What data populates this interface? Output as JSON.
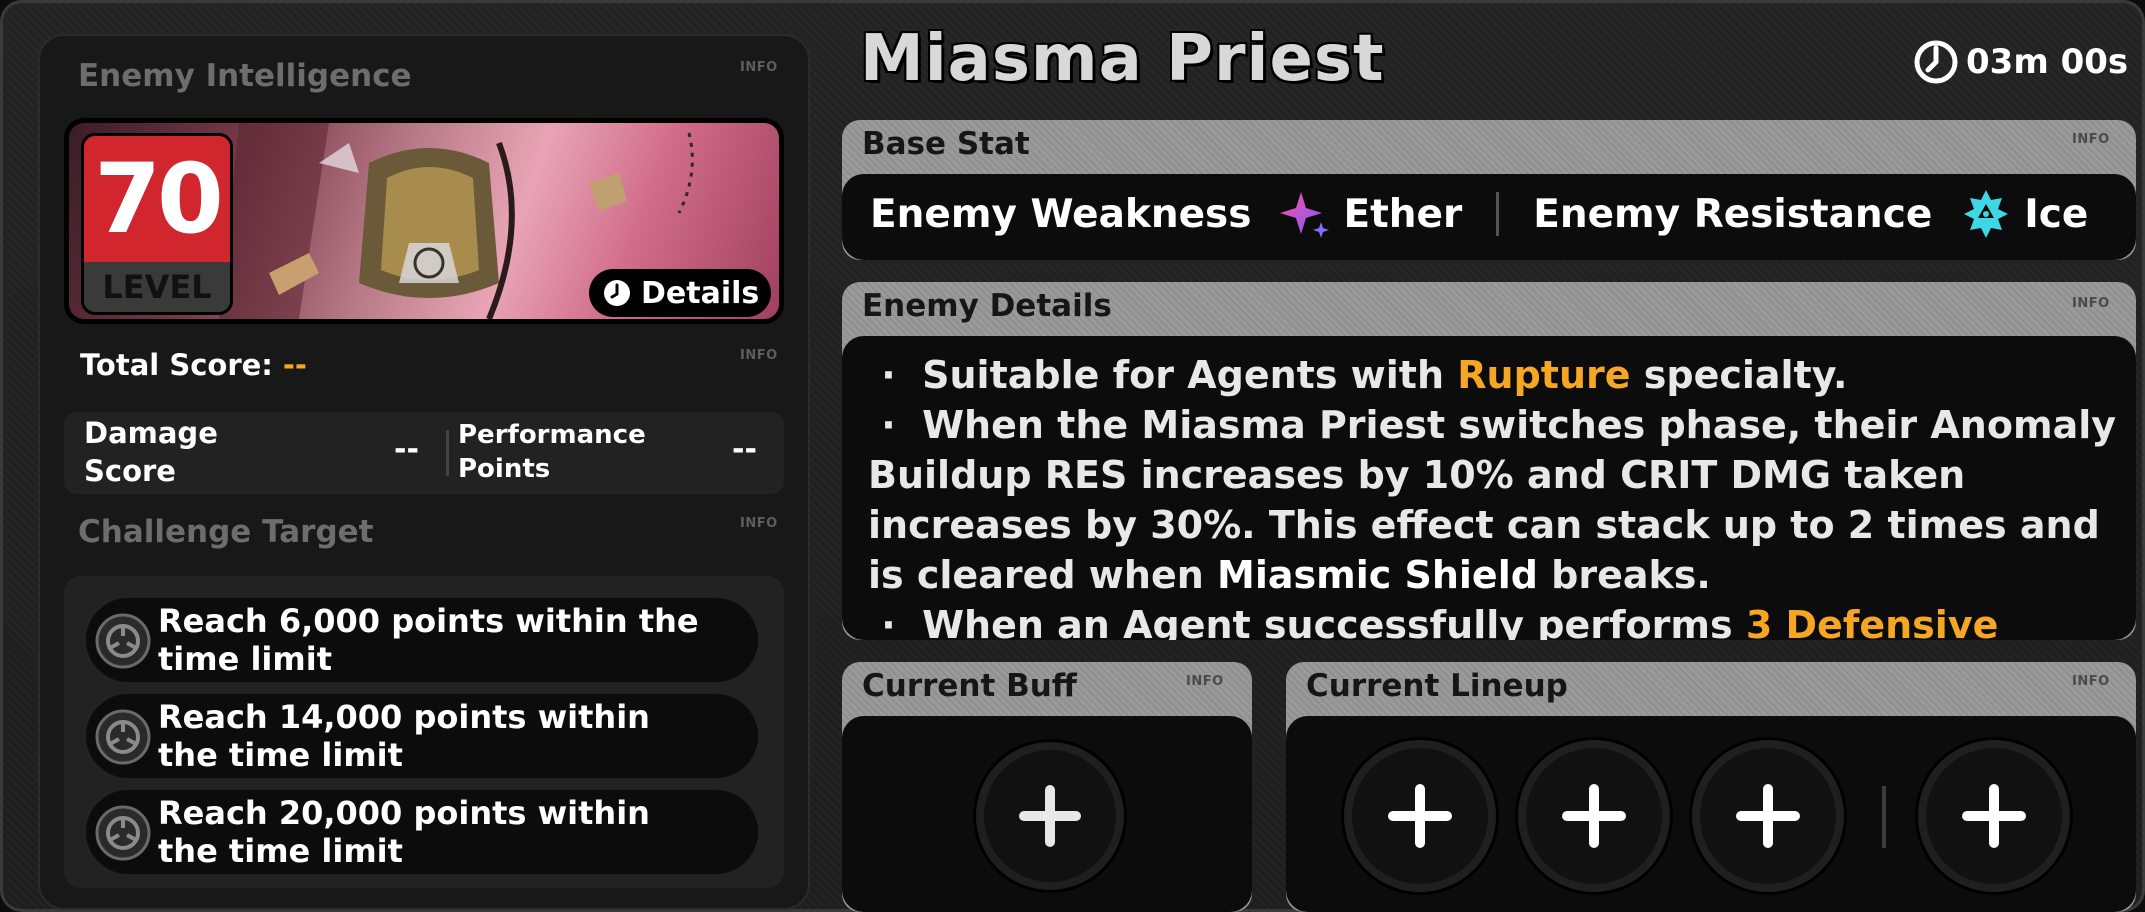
{
  "left": {
    "enemy_intelligence_title": "Enemy Intelligence",
    "info_label": "INFO",
    "level_value": "70",
    "level_label": "LEVEL",
    "details_button": "Details",
    "total_score_label": "Total Score:",
    "total_score_value": "--",
    "damage_score_label": "Damage Score",
    "damage_score_value": "--",
    "performance_points_label": "Performance Points",
    "performance_points_value": "--",
    "challenge_target_title": "Challenge Target",
    "targets": [
      "Reach 6,000 points within the time limit",
      "Reach 14,000 points within the time limit",
      "Reach 20,000 points within the time limit"
    ]
  },
  "header": {
    "enemy_name": "Miasma Priest",
    "timer": "03m 00s"
  },
  "base_stat": {
    "title": "Base Stat",
    "weakness_label": "Enemy Weakness",
    "weakness_element": "Ether",
    "weakness_icon": "ether-element-icon",
    "resistance_label": "Enemy Resistance",
    "resistance_element": "Ice",
    "resistance_icon": "ice-element-icon"
  },
  "enemy_details": {
    "title": "Enemy Details",
    "bullet": "·",
    "line1_prefix": "Suitable for Agents with",
    "line1_highlight": "Rupture",
    "line1_suffix": "specialty.",
    "line2_prefix": "When the Miasma Priest switches phase, their Anomaly Buildup RES increases by 10% and CRIT DMG taken increases by 30%. This effect can stack up to 2 times and is cleared when",
    "line2_strong": "Miasmic Shield",
    "line2_suffix": "breaks.",
    "line3_prefix": "When an Agent successfully performs",
    "line3_highlight": "3 Defensive"
  },
  "current_buff": {
    "title": "Current Buff"
  },
  "current_lineup": {
    "title": "Current Lineup"
  },
  "colors": {
    "accent_orange": "#f5a623",
    "level_red": "#d1262e",
    "panel_header_gray": "#9a9a9a",
    "ether_pink": "#ff4fa3",
    "ice_cyan": "#3fd6e6"
  }
}
